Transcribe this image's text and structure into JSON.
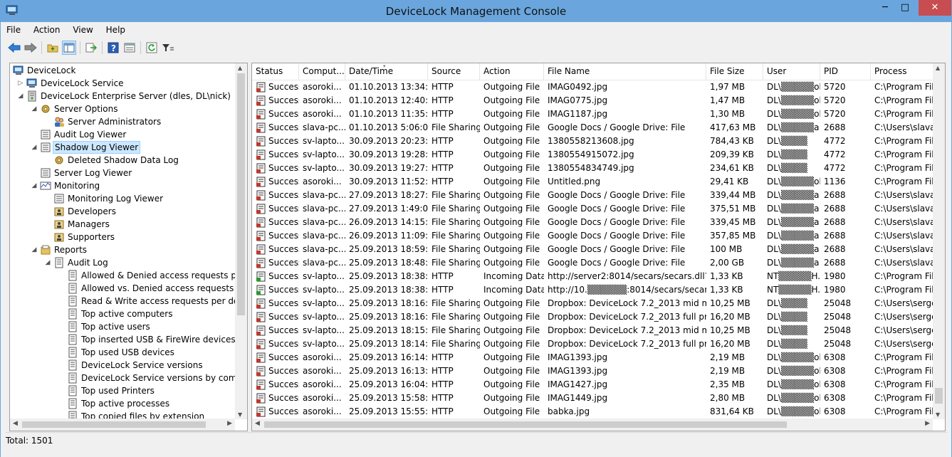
{
  "window": {
    "title": "DeviceLock Management Console"
  },
  "window_controls": {
    "minimize": "─",
    "maximize": "□",
    "close": "✕"
  },
  "menu": [
    "File",
    "Action",
    "View",
    "Help"
  ],
  "toolbar": [
    "back-arrow-icon",
    "forward-arrow-icon",
    "up-folder-icon",
    "show-hide-tree-icon",
    "export-list-icon",
    "help-icon",
    "properties-icon",
    "refresh-icon",
    "filter-icon"
  ],
  "tree": [
    {
      "label": "DeviceLock",
      "level": 0,
      "expander": "",
      "icon": "computer-icon"
    },
    {
      "label": "DeviceLock Service",
      "level": 1,
      "expander": "▷",
      "icon": "computer-icon"
    },
    {
      "label": "DeviceLock Enterprise Server (dles, DL\\nick)",
      "level": 1,
      "expander": "◢",
      "icon": "server-icon"
    },
    {
      "label": "Server Options",
      "level": 2,
      "expander": "◢",
      "icon": "gear-icon"
    },
    {
      "label": "Server Administrators",
      "level": 3,
      "expander": "",
      "icon": "users-icon"
    },
    {
      "label": "Audit Log Viewer",
      "level": 2,
      "expander": "",
      "icon": "log-icon"
    },
    {
      "label": "Shadow Log Viewer",
      "level": 2,
      "expander": "◢",
      "icon": "log-icon",
      "selected": true
    },
    {
      "label": "Deleted Shadow Data Log",
      "level": 3,
      "expander": "",
      "icon": "gear-icon"
    },
    {
      "label": "Server Log Viewer",
      "level": 2,
      "expander": "",
      "icon": "log-icon"
    },
    {
      "label": "Monitoring",
      "level": 2,
      "expander": "◢",
      "icon": "monitoring-icon"
    },
    {
      "label": "Monitoring Log Viewer",
      "level": 3,
      "expander": "",
      "icon": "log-icon"
    },
    {
      "label": "Developers",
      "level": 3,
      "expander": "",
      "icon": "group-icon"
    },
    {
      "label": "Managers",
      "level": 3,
      "expander": "",
      "icon": "group-icon"
    },
    {
      "label": "Supporters",
      "level": 3,
      "expander": "",
      "icon": "group-icon"
    },
    {
      "label": "Reports",
      "level": 2,
      "expander": "◢",
      "icon": "reports-icon"
    },
    {
      "label": "Audit Log",
      "level": 3,
      "expander": "◢",
      "icon": "report-icon"
    },
    {
      "label": "Allowed & Denied access requests per ch",
      "level": 4,
      "expander": "",
      "icon": "report-icon"
    },
    {
      "label": "Allowed vs. Denied access requests",
      "level": 4,
      "expander": "",
      "icon": "report-icon"
    },
    {
      "label": "Read & Write access requests per device t",
      "level": 4,
      "expander": "",
      "icon": "report-icon"
    },
    {
      "label": "Top active computers",
      "level": 4,
      "expander": "",
      "icon": "report-icon"
    },
    {
      "label": "Top active users",
      "level": 4,
      "expander": "",
      "icon": "report-icon"
    },
    {
      "label": "Top inserted USB & FireWire devices",
      "level": 4,
      "expander": "",
      "icon": "report-icon"
    },
    {
      "label": "Top used USB devices",
      "level": 4,
      "expander": "",
      "icon": "report-icon"
    },
    {
      "label": "DeviceLock Service versions",
      "level": 4,
      "expander": "",
      "icon": "report-icon"
    },
    {
      "label": "DeviceLock Service versions by computer",
      "level": 4,
      "expander": "",
      "icon": "report-icon"
    },
    {
      "label": "Top used Printers",
      "level": 4,
      "expander": "",
      "icon": "report-icon"
    },
    {
      "label": "Top active processes",
      "level": 4,
      "expander": "",
      "icon": "report-icon"
    },
    {
      "label": "Top copied files by extension",
      "level": 4,
      "expander": "",
      "icon": "report-icon"
    }
  ],
  "columns": [
    "Status",
    "Comput...",
    "Date/Time",
    "Source",
    "Action",
    "File Name",
    "File Size",
    "User",
    "PID",
    "Process"
  ],
  "rows": [
    [
      "Success",
      "asoroki...",
      "01.10.2013 13:34:57",
      "HTTP",
      "Outgoing File",
      "IMAG0492.jpg",
      "1,97 MB",
      "DL\\▒▒▒▒▒okin",
      "5720",
      "C:\\Program Fil"
    ],
    [
      "Success",
      "asoroki...",
      "01.10.2013 12:40:01",
      "HTTP",
      "Outgoing File",
      "IMAG0775.jpg",
      "1,47 MB",
      "DL\\▒▒▒▒▒okin",
      "5720",
      "C:\\Program Fil"
    ],
    [
      "Success",
      "asoroki...",
      "01.10.2013 11:35:33",
      "HTTP",
      "Outgoing File",
      "IMAG1187.jpg",
      "1,30 MB",
      "DL\\▒▒▒▒▒okin",
      "5720",
      "C:\\Program Fil"
    ],
    [
      "Success",
      "slava-pc...",
      "01.10.2013 5:06:02",
      "File Sharing",
      "Outgoing File",
      "Google Docs / Google Drive: File",
      "417,63 MB",
      "DL\\▒▒▒▒▒a",
      "2688",
      "C:\\Users\\slava\\"
    ],
    [
      "Success",
      "sv-lapto...",
      "30.09.2013 20:23:35",
      "HTTP",
      "Outgoing File",
      "1380558213608.jpg",
      "784,43 KB",
      "DL\\▒▒▒▒",
      "4772",
      "C:\\Program Fil"
    ],
    [
      "Success",
      "sv-lapto...",
      "30.09.2013 19:28:36",
      "HTTP",
      "Outgoing File",
      "1380554915072.jpg",
      "209,39 KB",
      "DL\\▒▒▒▒",
      "4772",
      "C:\\Program Fil"
    ],
    [
      "Success",
      "sv-lapto...",
      "30.09.2013 19:27:18",
      "HTTP",
      "Outgoing File",
      "1380554834749.jpg",
      "234,61 KB",
      "DL\\▒▒▒▒",
      "4772",
      "C:\\Program Fil"
    ],
    [
      "Success",
      "asoroki...",
      "30.09.2013 11:52:20",
      "HTTP",
      "Outgoing File",
      "Untitled.png",
      "29,41 KB",
      "DL\\▒▒▒▒▒okin",
      "1136",
      "C:\\Program Fil"
    ],
    [
      "Success",
      "slava-pc...",
      "27.09.2013 18:27:13",
      "File Sharing",
      "Outgoing File",
      "Google Docs / Google Drive: File",
      "339,44 MB",
      "DL\\▒▒▒▒▒a",
      "2688",
      "C:\\Users\\slava\\"
    ],
    [
      "Success",
      "slava-pc...",
      "27.09.2013 1:49:04",
      "File Sharing",
      "Outgoing File",
      "Google Docs / Google Drive: File",
      "375,51 MB",
      "DL\\▒▒▒▒▒a",
      "2688",
      "C:\\Users\\slava\\"
    ],
    [
      "Success",
      "slava-pc...",
      "26.09.2013 14:15:49",
      "File Sharing",
      "Outgoing File",
      "Google Docs / Google Drive: File",
      "339,45 MB",
      "DL\\▒▒▒▒▒a",
      "2688",
      "C:\\Users\\slava\\"
    ],
    [
      "Success",
      "slava-pc...",
      "26.09.2013 11:09:42",
      "File Sharing",
      "Outgoing File",
      "Google Docs / Google Drive: File",
      "357,85 MB",
      "DL\\▒▒▒▒▒a",
      "2688",
      "C:\\Users\\slava\\"
    ],
    [
      "Success",
      "slava-pc...",
      "25.09.2013 18:59:55",
      "File Sharing",
      "Outgoing File",
      "Google Docs / Google Drive: File",
      "100 MB",
      "DL\\▒▒▒▒▒a",
      "2688",
      "C:\\Users\\slava\\"
    ],
    [
      "Success",
      "slava-pc...",
      "25.09.2013 18:48:28",
      "File Sharing",
      "Outgoing File",
      "Google Docs / Google Drive: File",
      "2,00 GB",
      "DL\\▒▒▒▒▒a",
      "2688",
      "C:\\Users\\slava\\"
    ],
    [
      "Success",
      "sv-lapto...",
      "25.09.2013 18:38:48",
      "HTTP",
      "Incoming Data",
      "http://server2:8014/secars/secars.dll?h...",
      "1,33 KB",
      "NT▒▒▒▒▒H...",
      "1980",
      "C:\\Program Fil"
    ],
    [
      "Success",
      "sv-lapto...",
      "25.09.2013 18:38:46",
      "HTTP",
      "Incoming Data",
      "http://10.▒▒▒▒▒▒:8014/secars/secars.dll...",
      "1,33 KB",
      "NT▒▒▒▒▒H...",
      "1980",
      "C:\\Program Fil"
    ],
    [
      "Success",
      "sv-lapto...",
      "25.09.2013 18:16:10",
      "File Sharing",
      "Outgoing File",
      "Dropbox: DeviceLock 7.2_2013 mid mkt...",
      "10,25 MB",
      "DL\\▒▒▒▒",
      "25048",
      "C:\\Users\\serge"
    ],
    [
      "Success",
      "sv-lapto...",
      "25.09.2013 18:16:02",
      "File Sharing",
      "Outgoing File",
      "Dropbox: DeviceLock 7.2_2013 full pres...",
      "16,20 MB",
      "DL\\▒▒▒▒",
      "25048",
      "C:\\Users\\serge"
    ],
    [
      "Success",
      "sv-lapto...",
      "25.09.2013 18:15:06",
      "File Sharing",
      "Outgoing File",
      "Dropbox: DeviceLock 7.2_2013 mid mkt...",
      "10,25 MB",
      "DL\\▒▒▒▒",
      "25048",
      "C:\\Users\\serge"
    ],
    [
      "Success",
      "sv-lapto...",
      "25.09.2013 18:14:58",
      "File Sharing",
      "Outgoing File",
      "Dropbox: DeviceLock 7.2_2013 full pres...",
      "16,20 MB",
      "DL\\▒▒▒▒",
      "25048",
      "C:\\Users\\serge"
    ],
    [
      "Success",
      "asoroki...",
      "25.09.2013 16:14:36",
      "HTTP",
      "Outgoing File",
      "IMAG1393.jpg",
      "2,19 MB",
      "DL\\▒▒▒▒▒okin",
      "6308",
      "C:\\Program Fil"
    ],
    [
      "Success",
      "asoroki...",
      "25.09.2013 16:13:58",
      "HTTP",
      "Outgoing File",
      "IMAG1393.jpg",
      "2,19 MB",
      "DL\\▒▒▒▒▒okin",
      "6308",
      "C:\\Program Fil"
    ],
    [
      "Success",
      "asoroki...",
      "25.09.2013 16:04:36",
      "HTTP",
      "Outgoing File",
      "IMAG1427.jpg",
      "2,35 MB",
      "DL\\▒▒▒▒▒okin",
      "6308",
      "C:\\Program Fil"
    ],
    [
      "Success",
      "asoroki...",
      "25.09.2013 15:58:23",
      "HTTP",
      "Outgoing File",
      "IMAG1449.jpg",
      "2,80 MB",
      "DL\\▒▒▒▒▒okin",
      "6308",
      "C:\\Program Fil"
    ],
    [
      "Success",
      "asoroki...",
      "25.09.2013 15:55:32",
      "HTTP",
      "Outgoing File",
      "babka.jpg",
      "831,64 KB",
      "DL\\▒▒▒▒▒okin",
      "6308",
      "C:\\Program Fil"
    ]
  ],
  "status_bar": {
    "total": "Total: 1501"
  },
  "colors": {
    "titlebar": "#6aa6dd",
    "close_button": "#c74d50",
    "selection": "#cce8ff"
  }
}
